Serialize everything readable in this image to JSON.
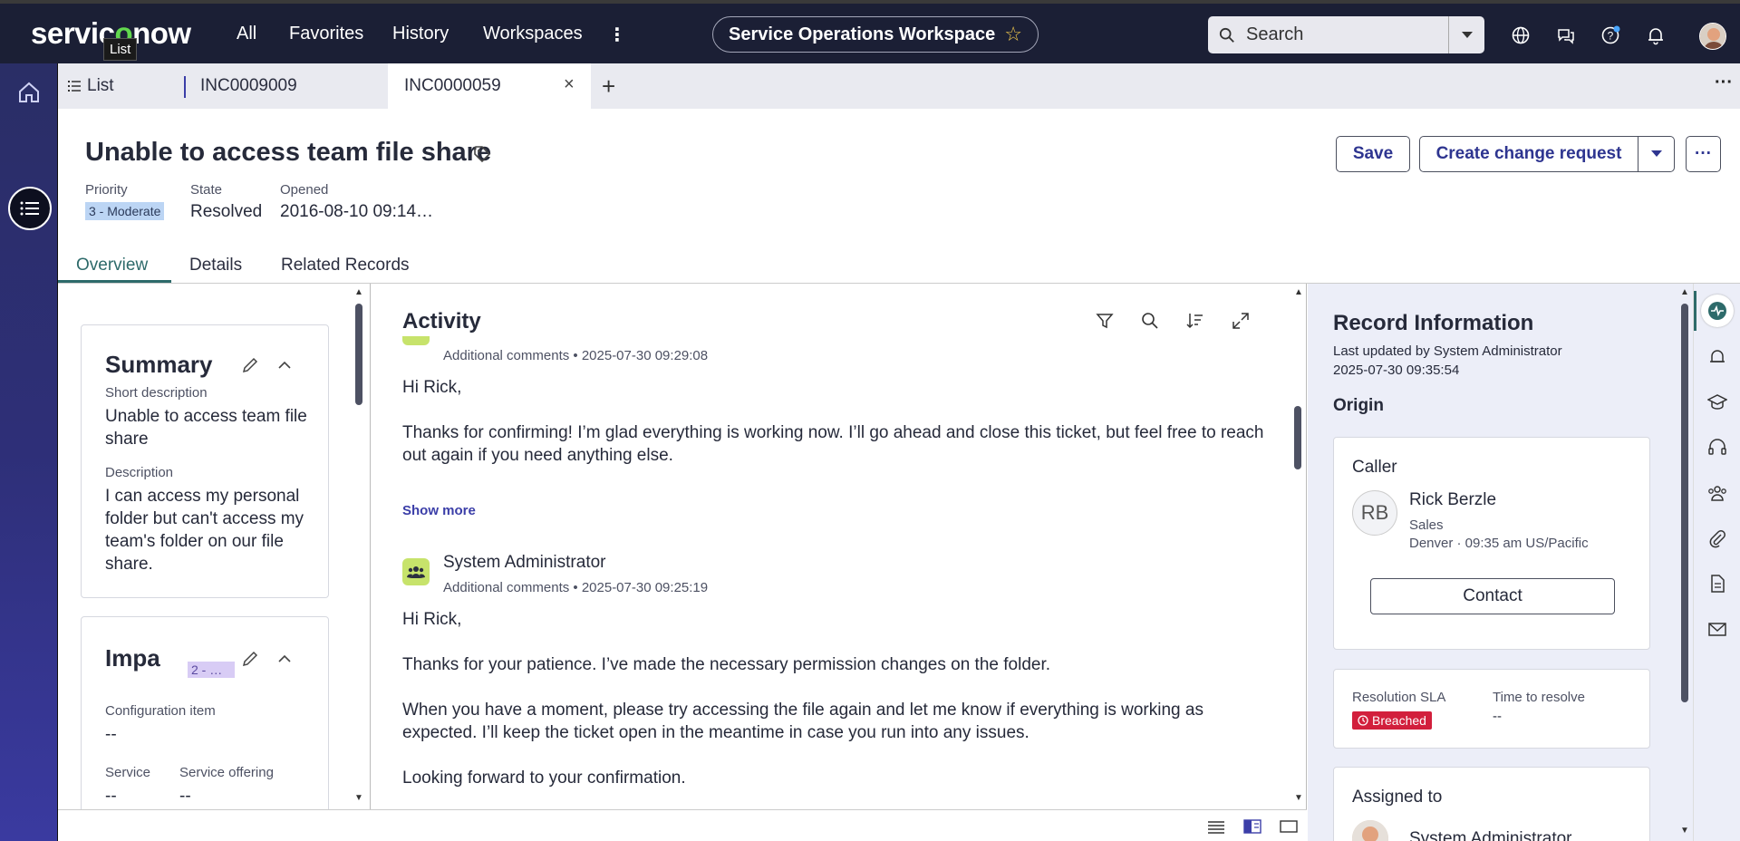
{
  "topbar": {
    "logo_pre": "servic",
    "logo_o": "o",
    "logo_post": "now",
    "tooltip": "List",
    "nav": [
      "All",
      "Favorites",
      "History",
      "Workspaces"
    ],
    "workspace": "Service Operations Workspace",
    "search_placeholder": "Search"
  },
  "tabs": [
    {
      "label": "List"
    },
    {
      "label": "INC0009009"
    },
    {
      "label": "INC0000059"
    }
  ],
  "record": {
    "title": "Unable to access team file share",
    "priority_label": "Priority",
    "priority_value": "3 - Moderate",
    "state_label": "State",
    "state_value": "Resolved",
    "opened_label": "Opened",
    "opened_value": "2016-08-10 09:14…",
    "save": "Save",
    "create_change": "Create change request"
  },
  "page_tabs": [
    "Overview",
    "Details",
    "Related Records"
  ],
  "summary": {
    "title": "Summary",
    "short_desc_label": "Short description",
    "short_desc": "Unable to access team file share",
    "desc_label": "Description",
    "desc": "I can access my personal folder but can't access my team's folder on our file share."
  },
  "impact": {
    "title": "Impa",
    "badge": "2 - …",
    "ci_label": "Configuration item",
    "ci_value": "--",
    "service_label": "Service",
    "service_value": "--",
    "offering_label": "Service offering",
    "offering_value": "--"
  },
  "activity": {
    "title": "Activity",
    "entry1_meta": "Additional comments • 2025-07-30 09:29:08",
    "entry1_greeting": "Hi Rick,",
    "entry1_body": "Thanks for confirming! I’m glad everything is working now. I’ll go ahead and close this ticket, but feel free to reach out again if you need anything else.",
    "show_more": "Show more",
    "entry2_author": "System Administrator",
    "entry2_meta": "Additional comments • 2025-07-30 09:25:19",
    "entry2_greeting": "Hi Rick,",
    "entry2_p1": "Thanks for your patience. I’ve made the necessary permission changes on the folder.",
    "entry2_p2": "When you have a moment, please try accessing the file again and let me know if everything is working as expected. I’ll keep the ticket open in the meantime in case you run into any issues.",
    "entry2_p3": "Looking forward to your confirmation."
  },
  "record_info": {
    "title": "Record Information",
    "updated_by": "Last updated by System Administrator",
    "updated_at": "2025-07-30 09:35:54",
    "origin": "Origin",
    "caller_label": "Caller",
    "caller_initials": "RB",
    "caller_name": "Rick Berzle",
    "caller_dept": "Sales",
    "caller_loc": "Denver · 09:35 am US/Pacific",
    "contact": "Contact",
    "sla_label": "Resolution SLA",
    "sla_value": "Breached",
    "ttr_label": "Time to resolve",
    "ttr_value": "--",
    "assigned_label": "Assigned to",
    "assigned_name": "System Administrator"
  },
  "colors": {
    "topbar": "#1b1f35",
    "accent": "#3b3ea8",
    "breached": "#d21f3c",
    "logo_green": "#62d84e"
  }
}
